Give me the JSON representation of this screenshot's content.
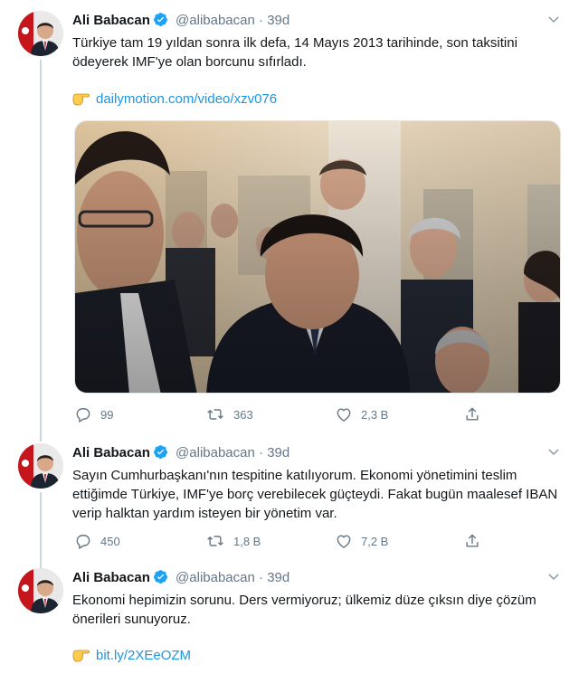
{
  "tweets": [
    {
      "author": "Ali Babacan",
      "handle": "@alibabacan",
      "separator": "·",
      "time": "39d",
      "text": "Türkiye tam 19 yıldan sonra ilk defa, 14 Mayıs 2013 tarihinde, son taksitini ödeyerek IMF'ye olan borcunu sıfırladı.",
      "link": "dailymotion.com/video/xzv076",
      "replies": "99",
      "retweets": "363",
      "likes": "2,3 B"
    },
    {
      "author": "Ali Babacan",
      "handle": "@alibabacan",
      "separator": "·",
      "time": "39d",
      "text": "Sayın Cumhurbaşkanı'nın tespitine katılıyorum. Ekonomi yönetimini teslim ettiğimde Türkiye, IMF'ye borç verebilecek güçteydi. Fakat bugün maalesef IBAN verip halktan yardım isteyen bir yönetim var.",
      "replies": "450",
      "retweets": "1,8 B",
      "likes": "7,2 B"
    },
    {
      "author": "Ali Babacan",
      "handle": "@alibabacan",
      "separator": "·",
      "time": "39d",
      "text": "Ekonomi hepimizin sorunu. Ders vermiyoruz; ülkemiz düze çıksın diye çözüm önerileri sunuyoruz.",
      "link": "bit.ly/2XEeOZM"
    }
  ],
  "colors": {
    "link": "#1b95e0",
    "muted": "#657786",
    "verified": "#1da1f2",
    "thread_line": "#ccd6dd"
  },
  "icons": [
    "verified-badge-icon",
    "caret-down-icon",
    "pointing-hand-emoji-icon",
    "reply-icon",
    "retweet-icon",
    "like-icon",
    "share-icon"
  ]
}
